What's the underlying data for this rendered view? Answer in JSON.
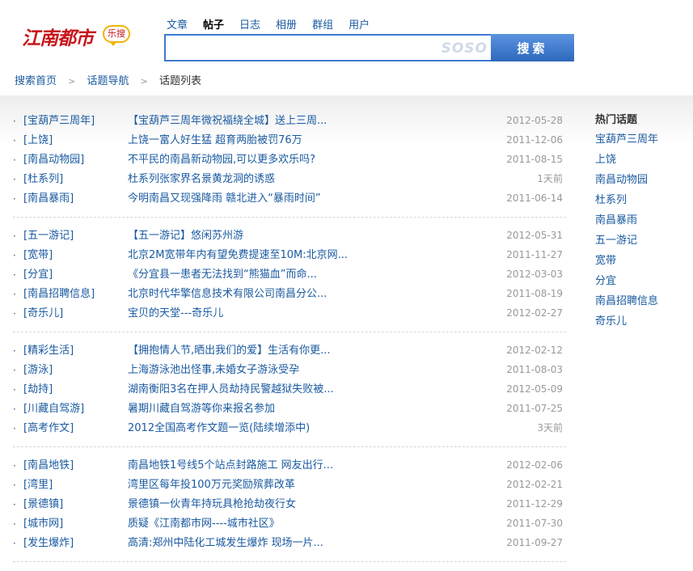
{
  "brand": {
    "logo_text": "江南都市",
    "logo_badge": "乐搜"
  },
  "tabs": [
    {
      "label": "文章",
      "active": false
    },
    {
      "label": "帖子",
      "active": true
    },
    {
      "label": "日志",
      "active": false
    },
    {
      "label": "相册",
      "active": false
    },
    {
      "label": "群组",
      "active": false
    },
    {
      "label": "用户",
      "active": false
    }
  ],
  "search": {
    "value": "",
    "watermark": "SOSO",
    "button_label": "搜索"
  },
  "breadcrumb": [
    "搜索首页",
    "话题导航",
    "话题列表"
  ],
  "groups": [
    [
      {
        "category": "[宝葫芦三周年]",
        "title": "【宝葫芦三周年微祝福绕全城】送上三周...",
        "date": "2012-05-28"
      },
      {
        "category": "[上饶]",
        "title": "上饶一富人好生猛 超育两胎被罚76万",
        "date": "2011-12-06"
      },
      {
        "category": "[南昌动物园]",
        "title": "不平民的南昌新动物园,可以更多欢乐吗?",
        "date": "2011-08-15"
      },
      {
        "category": "[杜系列]",
        "title": "杜系列张家界名景黄龙洞的诱惑",
        "date": "1天前"
      },
      {
        "category": "[南昌暴雨]",
        "title": "今明南昌又现强降雨 赣北进入“暴雨时间”",
        "date": "2011-06-14"
      }
    ],
    [
      {
        "category": "[五一游记]",
        "title": "【五一游记】悠闲苏州游",
        "date": "2012-05-31"
      },
      {
        "category": "[宽带]",
        "title": "北京2M宽带年内有望免费提速至10M:北京网...",
        "date": "2011-11-27"
      },
      {
        "category": "[分宜]",
        "title": "《分宜县一患者无法找到“熊猫血”而命...",
        "date": "2012-03-03"
      },
      {
        "category": "[南昌招聘信息]",
        "title": "北京时代华擎信息技术有限公司南昌分公...",
        "date": "2011-08-19"
      },
      {
        "category": "[奇乐儿]",
        "title": "宝贝的天堂---奇乐儿",
        "date": "2012-02-27"
      }
    ],
    [
      {
        "category": "[精彩生活]",
        "title": "【拥抱情人节,晒出我们的爱】生活有你更...",
        "date": "2012-02-12"
      },
      {
        "category": "[游泳]",
        "title": "上海游泳池出怪事,未婚女子游泳受孕",
        "date": "2011-08-03"
      },
      {
        "category": "[劫持]",
        "title": "湖南衡阳3名在押人员劫持民警越狱失败被...",
        "date": "2012-05-09"
      },
      {
        "category": "[川藏自驾游]",
        "title": "暑期川藏自驾游等你来报名参加",
        "date": "2011-07-25"
      },
      {
        "category": "[高考作文]",
        "title": "2012全国高考作文题一览(陆续增添中)",
        "date": "3天前"
      }
    ],
    [
      {
        "category": "[南昌地铁]",
        "title": "南昌地铁1号线5个站点封路施工 网友出行...",
        "date": "2012-02-06"
      },
      {
        "category": "[湾里]",
        "title": "湾里区每年投100万元奖励殡葬改革",
        "date": "2012-02-21"
      },
      {
        "category": "[景德镇]",
        "title": "景德镇一伙青年持玩具枪抢劫夜行女",
        "date": "2011-12-29"
      },
      {
        "category": "[城市网]",
        "title": "质疑《江南都市网----城市社区》",
        "date": "2011-07-30"
      },
      {
        "category": "[发生爆炸]",
        "title": "高清:郑州中陆化工城发生爆炸 现场一片...",
        "date": "2011-09-27"
      }
    ]
  ],
  "hot_topics": {
    "title": "热门话题",
    "items": [
      "宝葫芦三周年",
      "上饶",
      "南昌动物园",
      "杜系列",
      "南昌暴雨",
      "五一游记",
      "宽带",
      "分宜",
      "南昌招聘信息",
      "奇乐儿"
    ]
  },
  "colors": {
    "link": "#1a5aa0",
    "brand_red": "#c8151b",
    "search_blue": "#3d7ad0"
  }
}
